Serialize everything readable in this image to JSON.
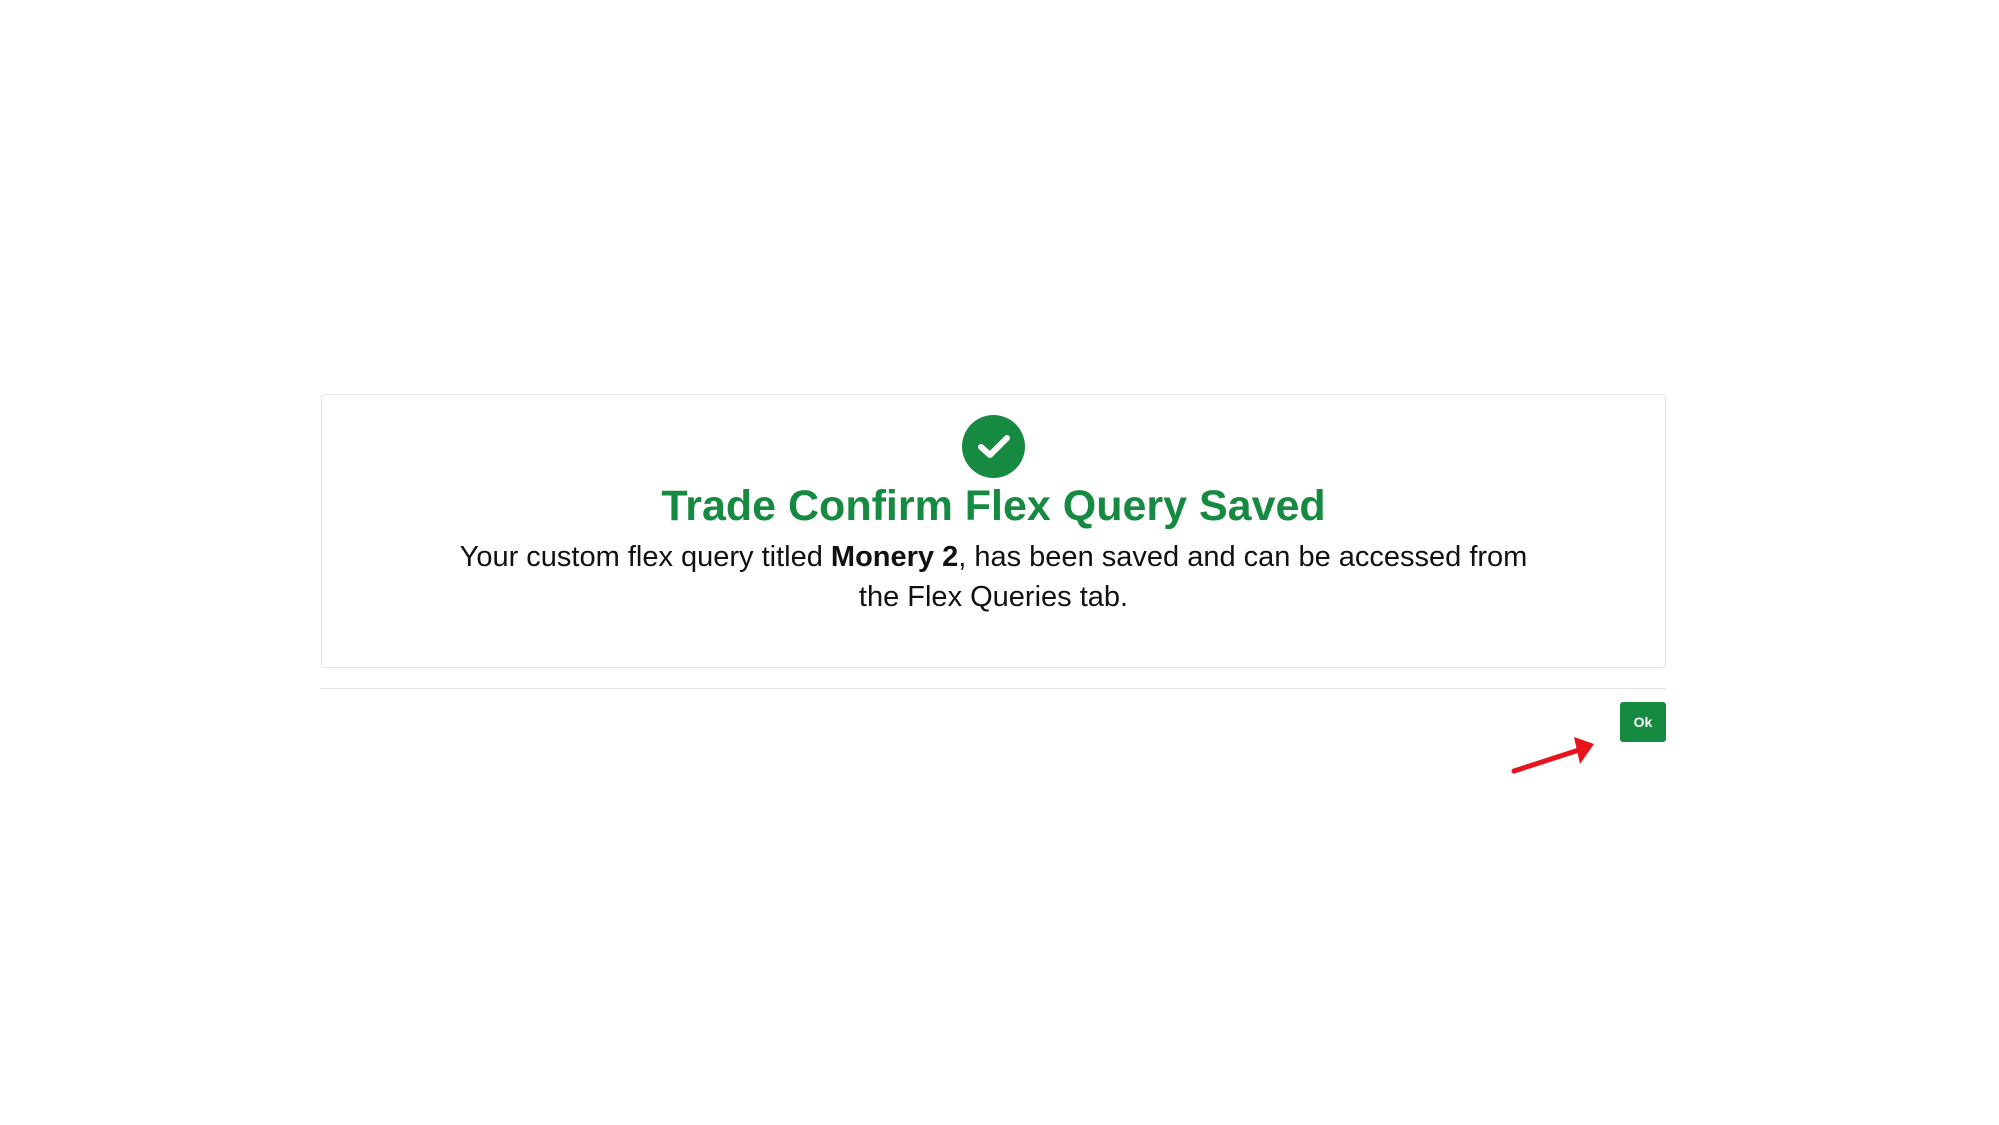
{
  "dialog": {
    "title": "Trade Confirm Flex Query Saved",
    "message_before": "Your custom flex query titled ",
    "query_name": "Monery 2",
    "message_after": ", has been saved and can be accessed from the Flex Queries tab.",
    "icon": "check-circle-icon",
    "accent_color": "#178a41"
  },
  "footer": {
    "ok_label": "Ok"
  },
  "annotation": {
    "icon": "red-arrow-icon",
    "color": "#e8141b"
  }
}
